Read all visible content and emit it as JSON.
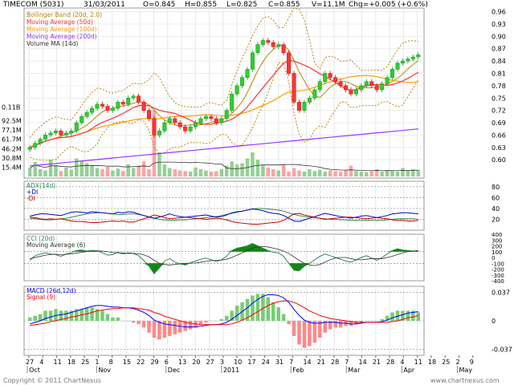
{
  "header": {
    "ticker": "TIMECOM (5031)",
    "date": "31/03/2011",
    "open": "O=0.845",
    "high": "H=0.855",
    "low": "L=0.825",
    "close": "C=0.855",
    "volume": "V=11.1M",
    "change": "Chg=+0.005 (+0.6%)"
  },
  "footer": {
    "copyright": "Copyright © 2011 ChartNexus",
    "url": "www.chartnexus.com"
  },
  "colors": {
    "up": "#33cc33",
    "down": "#ff3333",
    "bollinger": "#b8860b",
    "ma50": "#ff3333",
    "ma100": "#ff9900",
    "ma200": "#9933ff",
    "volume_ma": "#333333",
    "adx": "#2e8b57",
    "plus_di": "#0000cc",
    "minus_di": "#cc0000",
    "macd": "#0000ff",
    "signal": "#ff0000"
  },
  "chart_data": [
    {
      "type": "candlestick",
      "panel": "price",
      "legend": [
        {
          "label": "Bollinger Band (20d, 2.0)",
          "color_key": "bollinger"
        },
        {
          "label": "Moving Average (50d)",
          "color_key": "ma50"
        },
        {
          "label": "Moving Average (100d)",
          "color_key": "ma100"
        },
        {
          "label": "Moving Average (200d)",
          "color_key": "ma200"
        },
        {
          "label": "Volume MA (14d)",
          "color_key": "volume_ma"
        }
      ],
      "y_ticks": [
        "0.96",
        "0.93",
        "0.90",
        "0.87",
        "0.84",
        "0.81",
        "0.78",
        "0.75",
        "0.72",
        "0.69",
        "0.66",
        "0.63",
        "0.60"
      ],
      "ylim": [
        0.575,
        0.965
      ],
      "volume_ticks": [
        "0.11B",
        "92.5M",
        "77.1M",
        "61.7M",
        "46.2M",
        "30.8M",
        "15.4M"
      ],
      "close": [
        0.63,
        0.64,
        0.65,
        0.66,
        0.665,
        0.67,
        0.66,
        0.665,
        0.67,
        0.69,
        0.705,
        0.715,
        0.725,
        0.735,
        0.73,
        0.72,
        0.725,
        0.74,
        0.735,
        0.75,
        0.755,
        0.74,
        0.72,
        0.7,
        0.66,
        0.67,
        0.69,
        0.7,
        0.69,
        0.68,
        0.67,
        0.68,
        0.69,
        0.7,
        0.705,
        0.7,
        0.69,
        0.7,
        0.72,
        0.76,
        0.78,
        0.8,
        0.82,
        0.86,
        0.88,
        0.89,
        0.885,
        0.875,
        0.88,
        0.86,
        0.81,
        0.74,
        0.72,
        0.74,
        0.75,
        0.77,
        0.79,
        0.81,
        0.8,
        0.79,
        0.78,
        0.77,
        0.76,
        0.77,
        0.78,
        0.79,
        0.78,
        0.77,
        0.785,
        0.8,
        0.82,
        0.835,
        0.84,
        0.845,
        0.85,
        0.855
      ],
      "volume_millions": [
        14,
        24,
        12,
        10,
        28,
        19,
        9,
        15,
        11,
        30,
        25,
        22,
        18,
        14,
        12,
        16,
        10,
        13,
        9,
        20,
        14,
        18,
        25,
        12,
        110,
        40,
        20,
        14,
        12,
        10,
        9,
        8,
        15,
        12,
        10,
        8,
        9,
        12,
        18,
        25,
        20,
        22,
        30,
        40,
        28,
        18,
        15,
        12,
        10,
        20,
        8,
        14,
        10,
        8,
        12,
        9,
        11,
        8,
        10,
        9,
        8,
        10,
        18,
        9,
        8,
        7,
        9,
        12,
        8,
        10,
        9,
        8,
        14,
        10,
        12,
        11
      ]
    },
    {
      "type": "line",
      "panel": "adx",
      "series": [
        {
          "name": "ADX(14d)",
          "color_key": "adx"
        },
        {
          "name": "+DI",
          "color_key": "plus_di"
        },
        {
          "name": "-DI",
          "color_key": "minus_di"
        }
      ],
      "y_ticks": [
        "80",
        "60",
        "40",
        "20"
      ],
      "ylim": [
        0,
        90
      ],
      "adx": [
        22,
        21,
        20,
        19,
        19,
        20,
        21,
        22,
        24,
        26,
        28,
        30,
        31,
        32,
        32,
        31,
        30,
        29,
        29,
        30,
        30,
        29,
        27,
        25,
        22,
        20,
        19,
        18,
        18,
        19,
        19,
        20,
        21,
        22,
        23,
        24,
        25,
        27,
        29,
        31,
        33,
        35,
        37,
        39,
        40,
        40,
        39,
        38,
        37,
        35,
        32,
        29,
        27,
        25,
        24,
        23,
        22,
        21,
        20,
        20,
        19,
        19,
        18,
        18,
        18,
        18,
        18,
        18,
        18,
        19,
        20,
        21,
        21,
        21,
        21,
        20
      ],
      "plus_di": [
        26,
        28,
        30,
        30,
        29,
        28,
        27,
        30,
        33,
        34,
        33,
        32,
        34,
        33,
        32,
        31,
        30,
        33,
        32,
        34,
        33,
        30,
        27,
        24,
        22,
        24,
        27,
        30,
        27,
        25,
        24,
        25,
        26,
        27,
        28,
        26,
        24,
        25,
        28,
        32,
        34,
        35,
        37,
        39,
        38,
        36,
        33,
        31,
        30,
        27,
        22,
        17,
        16,
        19,
        22,
        25,
        28,
        31,
        29,
        27,
        25,
        24,
        22,
        24,
        26,
        27,
        25,
        23,
        25,
        27,
        30,
        31,
        32,
        32,
        31,
        30
      ],
      "minus_di": [
        24,
        23,
        21,
        20,
        21,
        20,
        21,
        19,
        17,
        16,
        16,
        15,
        14,
        14,
        15,
        16,
        17,
        16,
        17,
        15,
        15,
        18,
        21,
        24,
        28,
        26,
        23,
        21,
        22,
        23,
        24,
        23,
        22,
        21,
        20,
        21,
        22,
        21,
        19,
        16,
        14,
        13,
        12,
        11,
        11,
        12,
        13,
        14,
        15,
        18,
        24,
        30,
        31,
        28,
        26,
        24,
        22,
        20,
        21,
        22,
        23,
        24,
        24,
        23,
        22,
        21,
        22,
        23,
        22,
        21,
        19,
        18,
        18,
        17,
        17,
        18
      ]
    },
    {
      "type": "line",
      "panel": "cci",
      "series": [
        {
          "name": "CCI (20d)",
          "color_key": "adx"
        },
        {
          "name": "Moving Average (6)",
          "color_key": "volume_ma"
        }
      ],
      "y_ticks": [
        "400",
        "300",
        "200",
        "100",
        "0",
        "-100",
        "-200",
        "-300",
        "-400"
      ],
      "ylim": [
        -400,
        400
      ],
      "cci": [
        -50,
        30,
        60,
        80,
        60,
        50,
        20,
        60,
        80,
        120,
        130,
        110,
        120,
        110,
        80,
        40,
        50,
        90,
        60,
        80,
        70,
        30,
        -50,
        -150,
        -280,
        -180,
        -60,
        -20,
        -80,
        -110,
        -130,
        -90,
        -60,
        -30,
        -10,
        -40,
        -70,
        -40,
        20,
        120,
        160,
        180,
        200,
        240,
        200,
        160,
        120,
        90,
        80,
        20,
        -100,
        -220,
        -230,
        -150,
        -100,
        -40,
        20,
        60,
        30,
        0,
        -30,
        -60,
        -80,
        -40,
        0,
        30,
        -10,
        -50,
        0,
        60,
        120,
        150,
        130,
        120,
        110,
        110
      ],
      "ma": [
        -20,
        0,
        20,
        40,
        50,
        55,
        50,
        55,
        60,
        75,
        90,
        100,
        110,
        115,
        110,
        100,
        85,
        80,
        75,
        70,
        70,
        65,
        45,
        10,
        -50,
        -100,
        -120,
        -130,
        -120,
        -110,
        -100,
        -100,
        -95,
        -80,
        -65,
        -55,
        -50,
        -45,
        -30,
        0,
        40,
        80,
        120,
        160,
        180,
        190,
        180,
        160,
        140,
        110,
        70,
        10,
        -50,
        -100,
        -130,
        -140,
        -120,
        -80,
        -40,
        -10,
        0,
        0,
        -20,
        -40,
        -40,
        -30,
        -20,
        -20,
        -20,
        0,
        20,
        50,
        80,
        100,
        110,
        120
      ]
    },
    {
      "type": "line",
      "panel": "macd",
      "series": [
        {
          "name": "MACD (26d,12d)",
          "color_key": "macd"
        },
        {
          "name": "Signal (9)",
          "color_key": "signal"
        }
      ],
      "y_ticks": [
        "0.037",
        "0",
        "-0.037"
      ],
      "ylim": [
        -0.045,
        0.045
      ],
      "macd": [
        -0.004,
        -0.002,
        0.0,
        0.003,
        0.005,
        0.007,
        0.008,
        0.009,
        0.011,
        0.013,
        0.015,
        0.017,
        0.019,
        0.02,
        0.02,
        0.019,
        0.018,
        0.018,
        0.017,
        0.017,
        0.016,
        0.014,
        0.011,
        0.007,
        0.001,
        -0.002,
        -0.004,
        -0.005,
        -0.006,
        -0.007,
        -0.008,
        -0.008,
        -0.008,
        -0.007,
        -0.006,
        -0.005,
        -0.005,
        -0.004,
        -0.002,
        0.002,
        0.007,
        0.012,
        0.017,
        0.023,
        0.028,
        0.032,
        0.034,
        0.034,
        0.033,
        0.03,
        0.024,
        0.015,
        0.007,
        0.001,
        -0.002,
        -0.003,
        -0.003,
        -0.002,
        -0.002,
        -0.002,
        -0.003,
        -0.003,
        -0.004,
        -0.004,
        -0.003,
        -0.002,
        -0.002,
        -0.002,
        -0.001,
        0.001,
        0.004,
        0.006,
        0.008,
        0.01,
        0.011,
        0.012
      ],
      "signal": [
        -0.006,
        -0.005,
        -0.004,
        -0.003,
        -0.001,
        0.0,
        0.002,
        0.003,
        0.005,
        0.006,
        0.008,
        0.009,
        0.011,
        0.013,
        0.014,
        0.015,
        0.016,
        0.016,
        0.017,
        0.017,
        0.017,
        0.016,
        0.015,
        0.014,
        0.011,
        0.009,
        0.006,
        0.004,
        0.002,
        0.0,
        -0.002,
        -0.003,
        -0.004,
        -0.005,
        -0.005,
        -0.005,
        -0.005,
        -0.005,
        -0.005,
        -0.004,
        -0.002,
        0.001,
        0.004,
        0.008,
        0.012,
        0.016,
        0.02,
        0.023,
        0.025,
        0.026,
        0.026,
        0.024,
        0.021,
        0.017,
        0.013,
        0.01,
        0.007,
        0.005,
        0.003,
        0.002,
        0.001,
        0.0,
        -0.001,
        -0.002,
        -0.002,
        -0.002,
        -0.002,
        -0.002,
        -0.002,
        -0.002,
        -0.001,
        0.0,
        0.002,
        0.004,
        0.005,
        0.007
      ]
    }
  ],
  "x_axis": {
    "day_labels": [
      "27",
      "4",
      "11",
      "18",
      "25",
      "1",
      "8",
      "15",
      "22",
      "29",
      "6",
      "13",
      "20",
      "27",
      "3",
      "10",
      "17",
      "24",
      "31",
      "7",
      "14",
      "21",
      "28",
      "7",
      "14",
      "21",
      "28",
      "4",
      "11",
      "18",
      "25",
      "2",
      "9"
    ],
    "month_labels": [
      "Oct",
      "Nov",
      "Dec",
      "2011",
      "Feb",
      "Mar",
      "Apr",
      "May"
    ]
  }
}
